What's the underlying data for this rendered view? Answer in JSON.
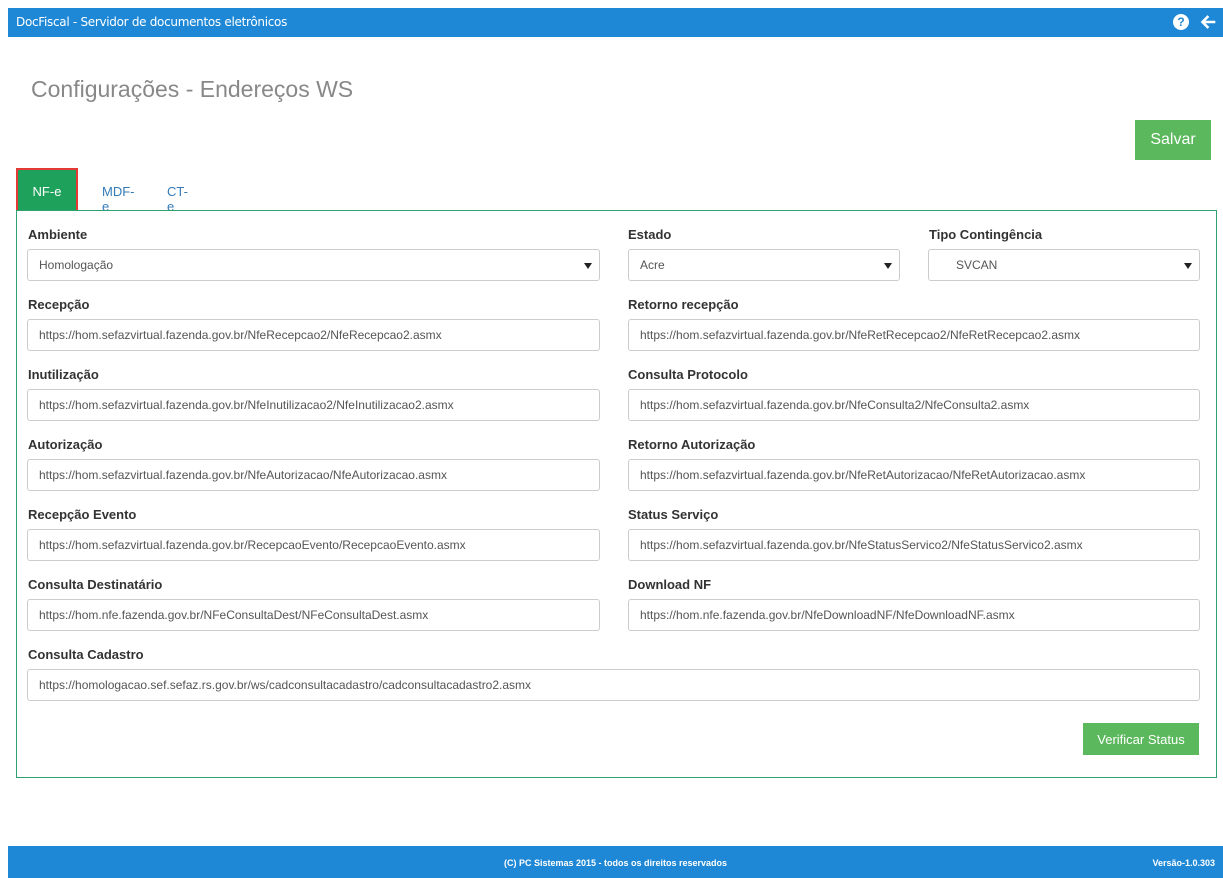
{
  "window": {
    "title": "DocFiscal - Servidor de documentos eletrônicos",
    "help_icon": "question-circle-icon",
    "back_icon": "arrow-left-icon"
  },
  "page": {
    "title": "Configurações - Endereços WS",
    "save_label": "Salvar"
  },
  "tabs": [
    {
      "label": "NF-e",
      "active": true
    },
    {
      "label": "MDF-e",
      "active": false
    },
    {
      "label": "CT-e",
      "active": false
    }
  ],
  "form": {
    "ambiente": {
      "label": "Ambiente",
      "value": "Homologação"
    },
    "estado": {
      "label": "Estado",
      "value": "Acre"
    },
    "tipo_contingencia": {
      "label": "Tipo Contingência",
      "value": "SVCAN"
    },
    "recepcao": {
      "label": "Recepção",
      "value": "https://hom.sefazvirtual.fazenda.gov.br/NfeRecepcao2/NfeRecepcao2.asmx"
    },
    "retorno_recepcao": {
      "label": "Retorno recepção",
      "value": "https://hom.sefazvirtual.fazenda.gov.br/NfeRetRecepcao2/NfeRetRecepcao2.asmx"
    },
    "inutilizacao": {
      "label": "Inutilização",
      "value": "https://hom.sefazvirtual.fazenda.gov.br/NfeInutilizacao2/NfeInutilizacao2.asmx"
    },
    "consulta_protocolo": {
      "label": "Consulta Protocolo",
      "value": "https://hom.sefazvirtual.fazenda.gov.br/NfeConsulta2/NfeConsulta2.asmx"
    },
    "autorizacao": {
      "label": "Autorização",
      "value": "https://hom.sefazvirtual.fazenda.gov.br/NfeAutorizacao/NfeAutorizacao.asmx"
    },
    "retorno_autorizacao": {
      "label": "Retorno Autorização",
      "value": "https://hom.sefazvirtual.fazenda.gov.br/NfeRetAutorizacao/NfeRetAutorizacao.asmx"
    },
    "recepcao_evento": {
      "label": "Recepção Evento",
      "value": "https://hom.sefazvirtual.fazenda.gov.br/RecepcaoEvento/RecepcaoEvento.asmx"
    },
    "status_servico": {
      "label": "Status Serviço",
      "value": "https://hom.sefazvirtual.fazenda.gov.br/NfeStatusServico2/NfeStatusServico2.asmx"
    },
    "consulta_destinatario": {
      "label": "Consulta Destinatário",
      "value": "https://hom.nfe.fazenda.gov.br/NFeConsultaDest/NFeConsultaDest.asmx"
    },
    "download_nf": {
      "label": "Download NF",
      "value": "https://hom.nfe.fazenda.gov.br/NfeDownloadNF/NfeDownloadNF.asmx"
    },
    "consulta_cadastro": {
      "label": "Consulta Cadastro",
      "value": "https://homologacao.sef.sefaz.rs.gov.br/ws/cadconsultacadastro/cadconsultacadastro2.asmx"
    },
    "verify_label": "Verificar Status"
  },
  "footer": {
    "copyright": "(C) PC Sistemas 2015 - todos os direitos reservados",
    "version": "Versão-1.0.303"
  },
  "colors": {
    "topbar": "#1e88d6",
    "tab_active": "#1ea15a",
    "button_green": "#5cb85c",
    "panel_border": "#2ea36f",
    "highlight": "#e53935"
  }
}
